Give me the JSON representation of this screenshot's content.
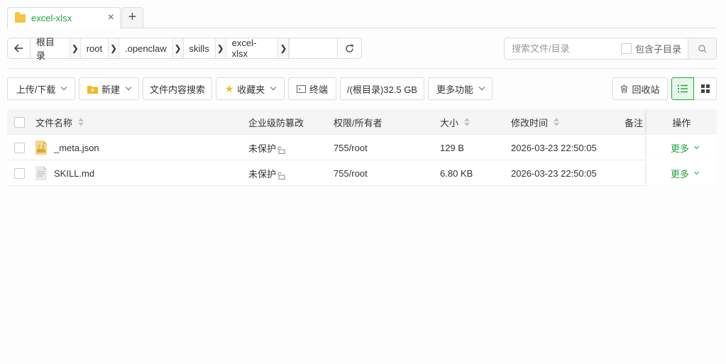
{
  "tabs": [
    {
      "label": "excel-xlsx"
    }
  ],
  "tab_close": "×",
  "tab_add": "+",
  "path": {
    "crumbs": [
      "根目录",
      "root",
      ".openclaw",
      "skills",
      "excel-xlsx"
    ]
  },
  "search": {
    "placeholder": "搜索文件/目录",
    "include_sub_label": "包含子目录"
  },
  "toolbar": {
    "upload_download": "上传/下载",
    "new": "新建",
    "content_search": "文件内容搜索",
    "favorites": "收藏夹",
    "terminal": "终端",
    "disk": "/(根目录)32.5 GB",
    "more_functions": "更多功能",
    "recycle_bin": "回收站"
  },
  "table": {
    "headers": {
      "name": "文件名称",
      "tamper": "企业级防篡改",
      "perm": "权限/所有者",
      "size": "大小",
      "mtime": "修改时间",
      "note": "备注",
      "op": "操作"
    },
    "rows": [
      {
        "name": "_meta.json",
        "icon": "json-file-icon",
        "tamper": "未保护",
        "perm": "755/root",
        "size": "129 B",
        "mtime": "2026-03-23 22:50:05",
        "op": "更多"
      },
      {
        "name": "SKILL.md",
        "icon": "text-file-icon",
        "tamper": "未保护",
        "perm": "755/root",
        "size": "6.80 KB",
        "mtime": "2026-03-23 22:50:05",
        "op": "更多"
      }
    ]
  },
  "colors": {
    "accent": "#20a53a",
    "folder": "#f5c542"
  }
}
